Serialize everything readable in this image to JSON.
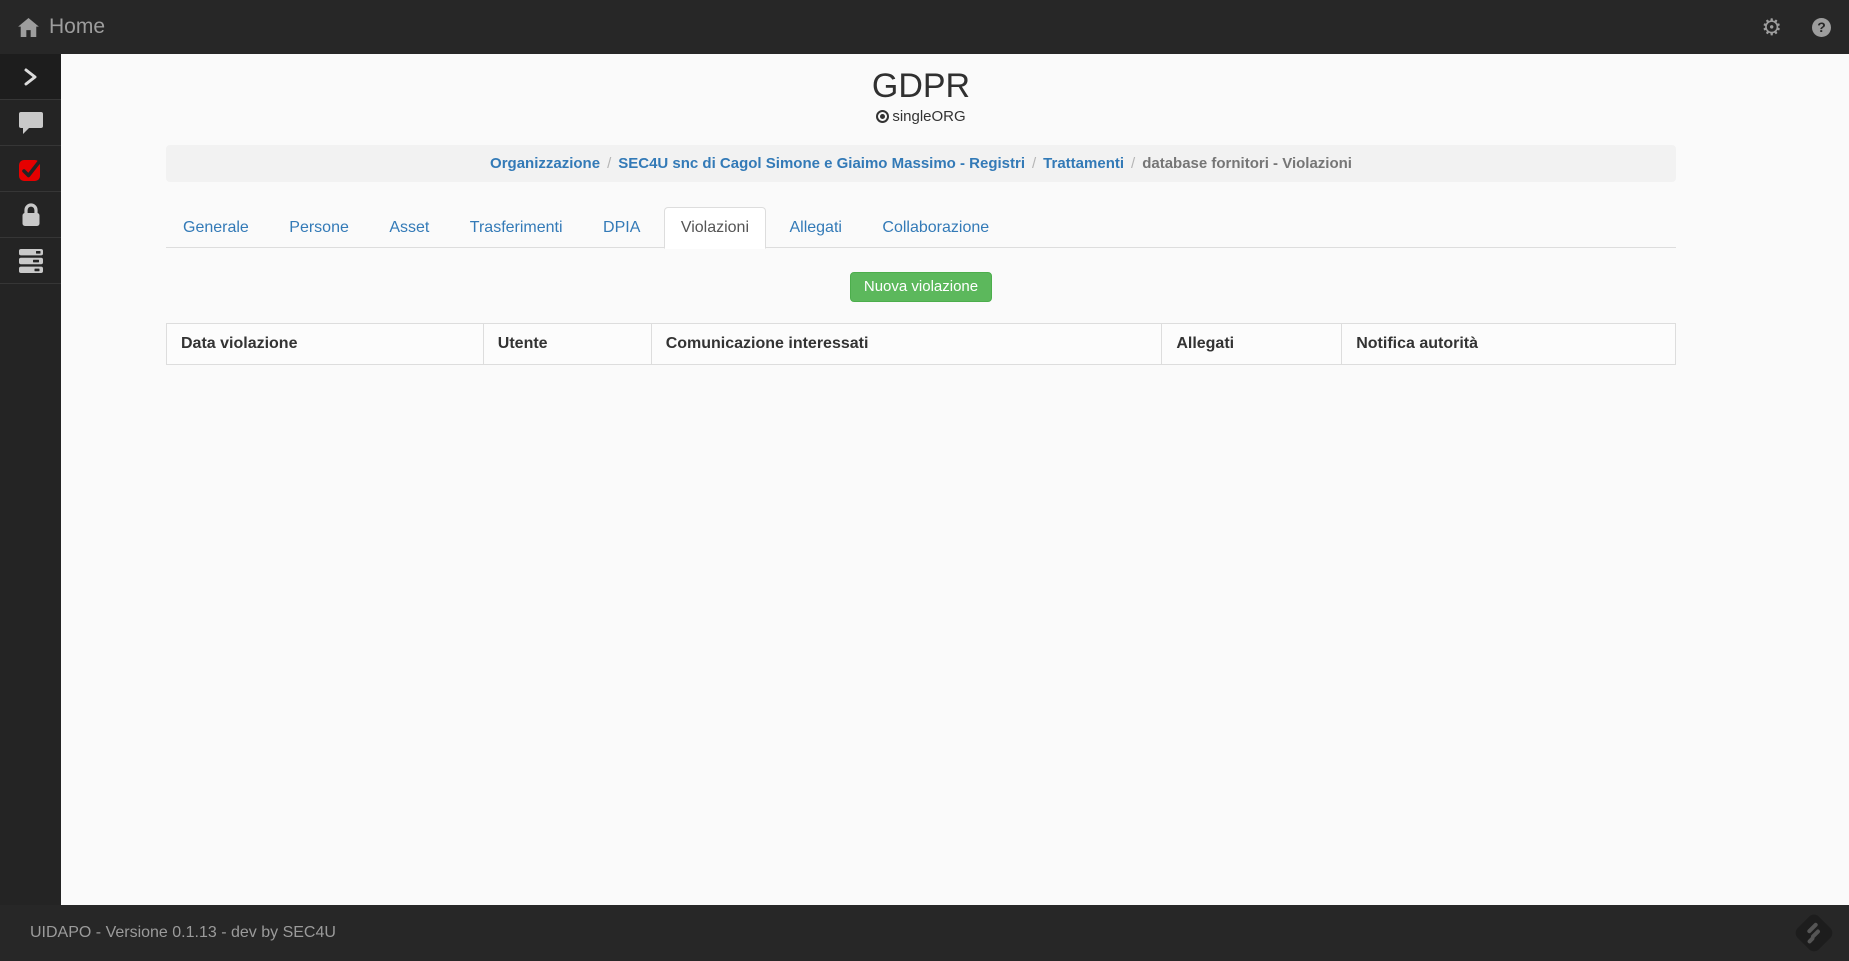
{
  "topbar": {
    "title": "Home",
    "icons": {
      "gear_glyph": "⚙",
      "help_glyph": "?"
    }
  },
  "sidebar": {
    "items": [
      {
        "icon": "chevron-right-icon"
      },
      {
        "icon": "chat-icon"
      },
      {
        "icon": "check-square-icon",
        "color": "#e60000"
      },
      {
        "icon": "lock-icon"
      },
      {
        "icon": "server-icon"
      }
    ]
  },
  "header": {
    "app_title": "GDPR",
    "org_badge": "singleORG"
  },
  "breadcrumb": {
    "separator": "/",
    "items": [
      {
        "label": "Organizzazione",
        "link": true
      },
      {
        "label": "SEC4U snc di Cagol Simone e Giaimo Massimo - Registri",
        "link": true
      },
      {
        "label": "Trattamenti",
        "link": true
      },
      {
        "label": "database fornitori - Violazioni",
        "link": false
      }
    ]
  },
  "tabs": [
    {
      "label": "Generale",
      "active": false
    },
    {
      "label": "Persone",
      "active": false
    },
    {
      "label": "Asset",
      "active": false
    },
    {
      "label": "Trasferimenti",
      "active": false
    },
    {
      "label": "DPIA",
      "active": false
    },
    {
      "label": "Violazioni",
      "active": true
    },
    {
      "label": "Allegati",
      "active": false
    },
    {
      "label": "Collaborazione",
      "active": false
    }
  ],
  "actions": {
    "new_violation_label": "Nuova violazione"
  },
  "table": {
    "columns": [
      "Data violazione",
      "Utente",
      "Comunicazione interessati",
      "Allegati",
      "Notifica autorità"
    ],
    "rows": []
  },
  "footer": {
    "text": "UIDAPO - Versione 0.1.13 - dev by SEC4U"
  },
  "colors": {
    "chrome_dark": "#272727",
    "accent_blue": "#337ab7",
    "success_green": "#5cb85c",
    "alert_red": "#e60000",
    "page_bg": "#fafafa",
    "border_gray": "#dddddd"
  }
}
